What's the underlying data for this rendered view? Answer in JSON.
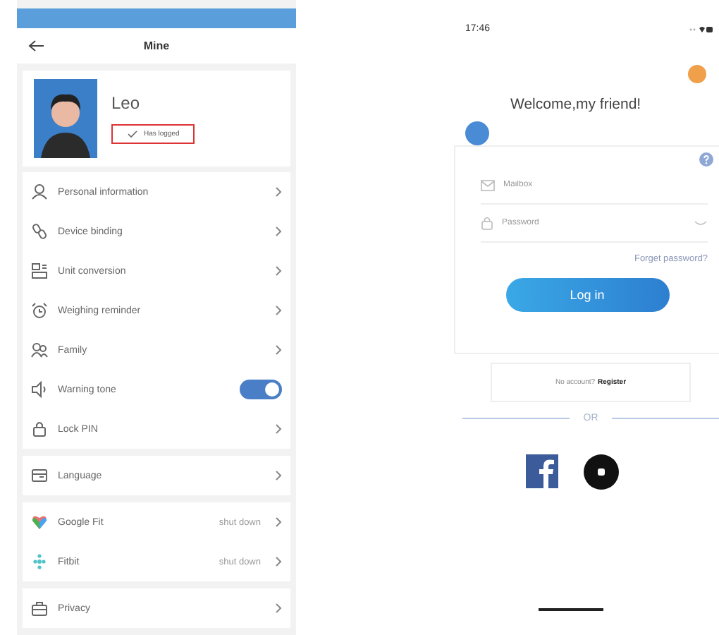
{
  "profile_screen": {
    "header": {
      "title": "Mine"
    },
    "profile": {
      "name": "Leo",
      "status": "Has logged",
      "checked": true
    },
    "menu_groups": [
      {
        "items": [
          {
            "label": "Personal information",
            "kind": "link"
          },
          {
            "label": "Device binding",
            "kind": "link"
          },
          {
            "label": "Unit conversion",
            "kind": "link"
          },
          {
            "label": "Weighing reminder",
            "kind": "link"
          },
          {
            "label": "Family",
            "kind": "link"
          },
          {
            "label": "Warning tone",
            "kind": "toggle",
            "on": true
          },
          {
            "label": "Lock PIN",
            "kind": "link"
          }
        ]
      },
      {
        "items": [
          {
            "label": "Language",
            "kind": "link"
          }
        ]
      },
      {
        "items": [
          {
            "label": "Google Fit",
            "kind": "link_value",
            "value": "shut down"
          },
          {
            "label": "Fitbit",
            "kind": "link_value",
            "value": "shut down"
          }
        ]
      },
      {
        "items": [
          {
            "label": "Privacy",
            "kind": "link"
          }
        ]
      }
    ]
  },
  "login_screen": {
    "status_bar": {
      "time": "17:46"
    },
    "title": "Welcome,my friend!",
    "fields": [
      {
        "placeholder": "Mailbox",
        "kind": "text"
      },
      {
        "placeholder": "Password",
        "kind": "password"
      }
    ],
    "forgot_link": "Forget password?",
    "login_button": "Log in",
    "register_prompt": {
      "text": "No account?",
      "link": "Register"
    },
    "divider_text": "OR"
  }
}
